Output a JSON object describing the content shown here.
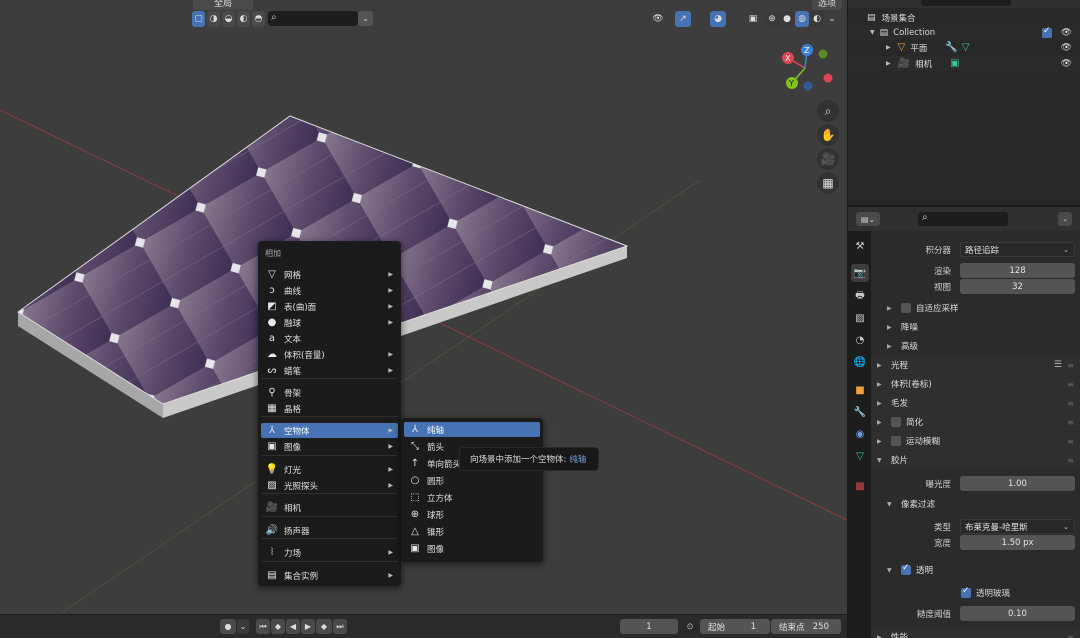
{
  "viewport": {
    "header": {
      "mode_label": "全局",
      "scene_label": "选项"
    },
    "gizmo": {
      "x": "X",
      "y": "Y",
      "z": "Z"
    }
  },
  "add_menu": {
    "title": "相加",
    "items": [
      {
        "label": "网格",
        "icon": "mesh-icon",
        "glyph": "▽",
        "submenu": true
      },
      {
        "label": "曲线",
        "icon": "curve-icon",
        "glyph": "ↄ",
        "submenu": true
      },
      {
        "label": "表(曲)面",
        "icon": "surface-icon",
        "glyph": "◩",
        "submenu": true
      },
      {
        "label": "融球",
        "icon": "metaball-icon",
        "glyph": "●",
        "submenu": true
      },
      {
        "label": "文本",
        "icon": "text-icon",
        "glyph": "a",
        "submenu": false
      },
      {
        "label": "体积(音量)",
        "icon": "volume-icon",
        "glyph": "☁",
        "submenu": true
      },
      {
        "label": "蜡笔",
        "icon": "grease-pencil-icon",
        "glyph": "ᔕ",
        "submenu": true
      },
      {
        "label": "骨架",
        "icon": "armature-icon",
        "glyph": "⚲",
        "submenu": false
      },
      {
        "label": "晶格",
        "icon": "lattice-icon",
        "glyph": "▦",
        "submenu": false
      },
      {
        "label": "空物体",
        "icon": "empty-icon",
        "glyph": "⅄",
        "submenu": true,
        "highlighted": true
      },
      {
        "label": "图像",
        "icon": "image-icon",
        "glyph": "▣",
        "submenu": true
      },
      {
        "label": "灯光",
        "icon": "light-icon",
        "glyph": "💡",
        "submenu": true
      },
      {
        "label": "光照探头",
        "icon": "light-probe-icon",
        "glyph": "▨",
        "submenu": true
      },
      {
        "label": "相机",
        "icon": "camera-icon",
        "glyph": "🎥",
        "submenu": false
      },
      {
        "label": "扬声器",
        "icon": "speaker-icon",
        "glyph": "🔊",
        "submenu": false
      },
      {
        "label": "力场",
        "icon": "force-field-icon",
        "glyph": "⦚",
        "submenu": true
      },
      {
        "label": "集合实例",
        "icon": "collection-instance-icon",
        "glyph": "▤",
        "submenu": true
      }
    ]
  },
  "empty_submenu": {
    "items": [
      {
        "label": "纯轴",
        "icon": "plain-axes-icon",
        "glyph": "⅄",
        "highlighted": true
      },
      {
        "label": "箭头",
        "icon": "arrows-icon",
        "glyph": "⤡"
      },
      {
        "label": "单向箭头",
        "icon": "single-arrow-icon",
        "glyph": "↑"
      },
      {
        "label": "圆形",
        "icon": "circle-icon",
        "glyph": "○"
      },
      {
        "label": "立方体",
        "icon": "cube-icon",
        "glyph": "⬚"
      },
      {
        "label": "球形",
        "icon": "sphere-icon",
        "glyph": "⊕"
      },
      {
        "label": "锥形",
        "icon": "cone-icon",
        "glyph": "△"
      },
      {
        "label": "图像",
        "icon": "image-icon",
        "glyph": "▣"
      }
    ]
  },
  "tooltip": {
    "text": "向场景中添加一个空物体:",
    "python": "纯轴"
  },
  "timeline": {
    "current_frame": "1",
    "start_label": "起始",
    "start_value": "1",
    "end_label": "结束点",
    "end_value": "250"
  },
  "outliner": {
    "root": "场景集合",
    "collection": "Collection",
    "objects": [
      {
        "name": "平面",
        "icon": "mesh-object-icon"
      },
      {
        "name": "相机",
        "icon": "camera-object-icon"
      }
    ]
  },
  "properties": {
    "integrator_label": "积分器",
    "integrator_value": "路径追踪",
    "render_label": "渲染",
    "render_value": "128",
    "viewport_label": "视图",
    "viewport_value": "32",
    "adaptive_sampling": "自适应采样",
    "denoise": "降噪",
    "advanced": "高级",
    "light_paths": "光程",
    "volumes": "体积(卷标)",
    "hair": "毛发",
    "simplify": "简化",
    "motion_blur": "运动模糊",
    "film": "胶片",
    "exposure_label": "曝光度",
    "exposure_value": "1.00",
    "pixel_filter": "像素过滤",
    "type_label": "类型",
    "type_value": "布莱克曼-哈里斯",
    "width_label": "宽度",
    "width_value": "1.50 px",
    "transparent": "透明",
    "transparent_glass": "透明玻璃",
    "roughness_label": "糙度阈值",
    "roughness_value": "0.10",
    "performance": "性能"
  },
  "colors": {
    "accent": "#4772b3",
    "axis_x": "#e04556",
    "axis_y": "#84c01f",
    "axis_z": "#3d7fd8"
  }
}
